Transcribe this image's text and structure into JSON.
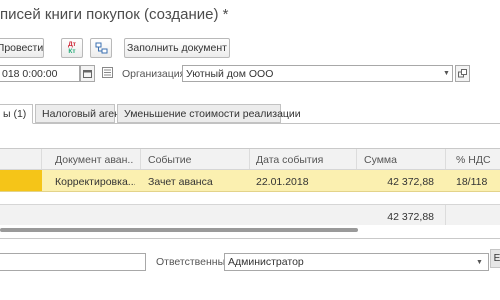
{
  "title": "писей книги покупок (создание) *",
  "toolbar": {
    "post_label": "Провести",
    "dtkt_label": "Дт\nКт",
    "fill_label": "Заполнить документ"
  },
  "header_fields": {
    "date_value": "018  0:00:00",
    "org_label": "Организация:",
    "org_value": "Уютный дом ООО"
  },
  "tabs": [
    {
      "label": "ы (1)",
      "active": true
    },
    {
      "label": "Налоговый агент",
      "active": false
    },
    {
      "label": "Уменьшение стоимости реализации",
      "active": false
    }
  ],
  "table": {
    "columns": [
      "Документ аван...",
      "Событие",
      "Дата события",
      "Сумма",
      "% НДС"
    ],
    "rows": [
      {
        "doc": "Корректировка...",
        "event": "Зачет аванса",
        "date": "22.01.2018",
        "sum": "42 372,88",
        "vat": "18/118"
      }
    ],
    "total_sum": "42 372,88"
  },
  "bottom": {
    "responsible_label": "Ответственный:",
    "responsible_value": "Администратор",
    "corner_label": "Е"
  },
  "colors": {
    "selected_row": "#fbf0b0",
    "row_marker": "#f5c518"
  }
}
